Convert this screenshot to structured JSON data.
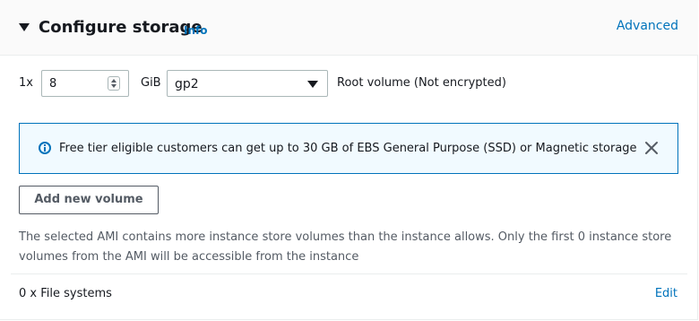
{
  "header": {
    "title": "Configure storage",
    "info_link": "Info",
    "advanced_link": "Advanced"
  },
  "volume": {
    "quantity": "1x",
    "size_value": "8",
    "unit": "GiB",
    "volume_type": "gp2",
    "description": "Root volume  (Not encrypted)"
  },
  "alert": {
    "message": "Free tier eligible customers can get up to 30 GB of EBS General Purpose (SSD) or Magnetic storage",
    "icon": "info-circle-icon",
    "close_icon": "close-icon"
  },
  "add_volume_button": "Add new volume",
  "note": "The selected AMI contains more instance store volumes than the instance allows. Only the first 0 instance store volumes from the AMI will be accessible from the instance",
  "file_systems": {
    "label": "0 x File systems",
    "edit_link": "Edit"
  },
  "colors": {
    "link": "#0073bb",
    "alert_bg": "#f1faff",
    "alert_border": "#0073bb",
    "text": "#16191f",
    "muted": "#545b64"
  }
}
